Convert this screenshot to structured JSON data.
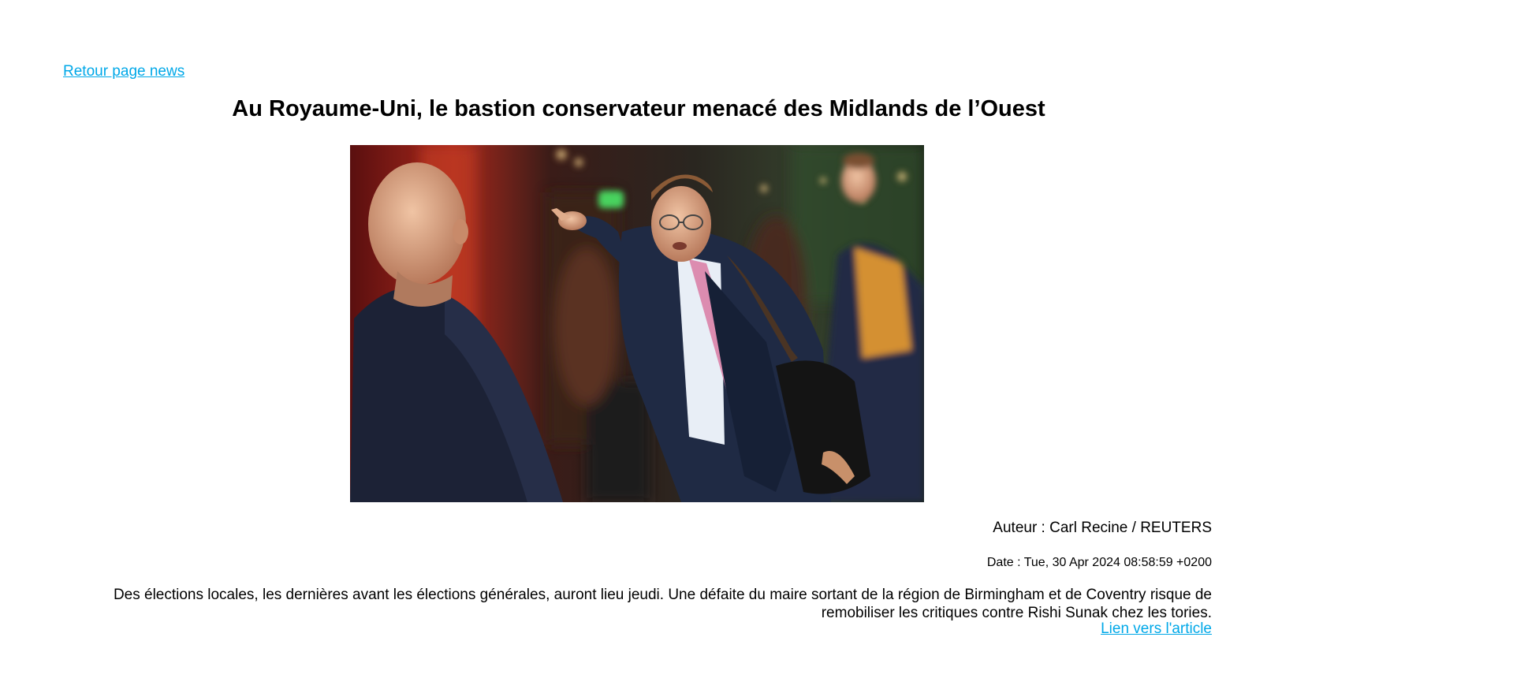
{
  "nav": {
    "back_label": "Retour page news"
  },
  "article": {
    "title": "Au Royaume-Uni, le bastion conservateur menacé des Midlands de l’Ouest",
    "author": "Auteur : Carl Recine / REUTERS",
    "date": "Date : Tue, 30 Apr 2024 08:58:59 +0200",
    "summary": "Des élections locales, les dernières avant les élections générales, auront lieu jeudi. Une défaite du maire sortant de la région de Birmingham et de Coventry risque de remobiliser les critiques contre Rishi Sunak chez les tories.",
    "link_label": "Lien vers l'article"
  },
  "colors": {
    "link": "#00a8e8",
    "text": "#000000",
    "background": "#ffffff"
  }
}
